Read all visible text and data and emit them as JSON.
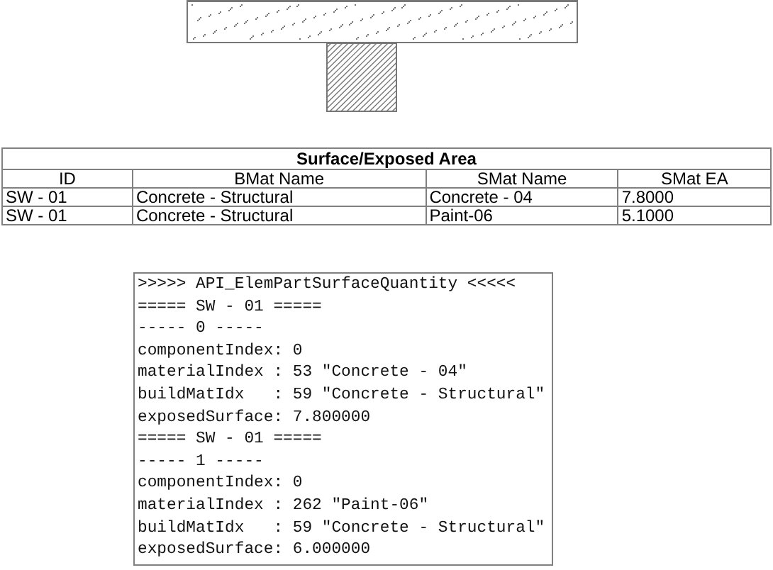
{
  "table": {
    "title": "Surface/Exposed Area",
    "columns": [
      "ID",
      "BMat Name",
      "SMat Name",
      "SMat EA"
    ],
    "rows": [
      [
        "SW - 01",
        "Concrete - Structural",
        "Concrete - 04",
        "7.8000"
      ],
      [
        "SW - 01",
        "Concrete - Structural",
        "Paint-06",
        "5.1000"
      ]
    ]
  },
  "console": {
    "lines": [
      ">>>>> API_ElemPartSurfaceQuantity <<<<<",
      "===== SW - 01 =====",
      "----- 0 -----",
      "componentIndex: 0",
      "materialIndex : 53 \"Concrete - 04\"",
      "buildMatIdx   : 59 \"Concrete - Structural\"",
      "exposedSurface: 7.800000",
      "===== SW - 01 =====",
      "----- 1 -----",
      "componentIndex: 0",
      "materialIndex : 262 \"Paint-06\"",
      "buildMatIdx   : 59 \"Concrete - Structural\"",
      "exposedSurface: 6.000000"
    ]
  }
}
